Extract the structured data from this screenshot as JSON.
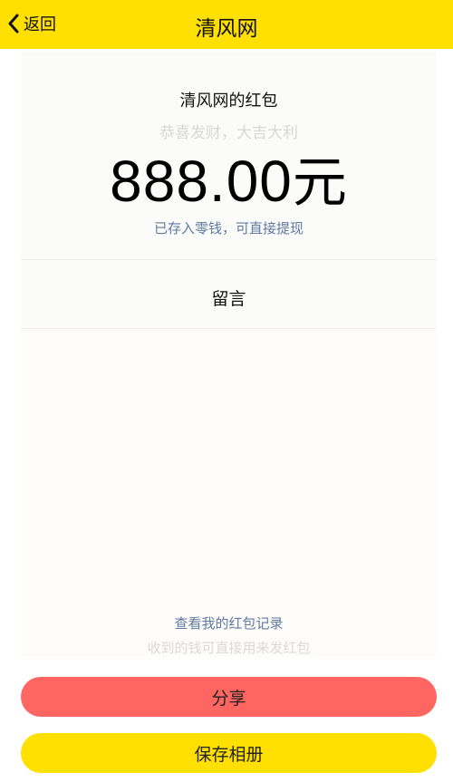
{
  "nav": {
    "back_label": "返回",
    "title": "清风网"
  },
  "packet": {
    "title": "清风网的红包",
    "blessing": "恭喜发财，大吉大利",
    "amount": "888.00",
    "unit": "元",
    "deposit_note": "已存入零钱，可直接提现",
    "message_label": "留言"
  },
  "records": {
    "link": "查看我的红包记录",
    "subtext": "收到的钱可直接用来发红包"
  },
  "buttons": {
    "share": "分享",
    "save": "保存相册"
  },
  "colors": {
    "nav_bg": "#ffe000",
    "share_button": "#ff6661",
    "save_button": "#ffe000",
    "link": "#5f7aa3"
  },
  "icons": {
    "back": "chevron-left-icon"
  }
}
